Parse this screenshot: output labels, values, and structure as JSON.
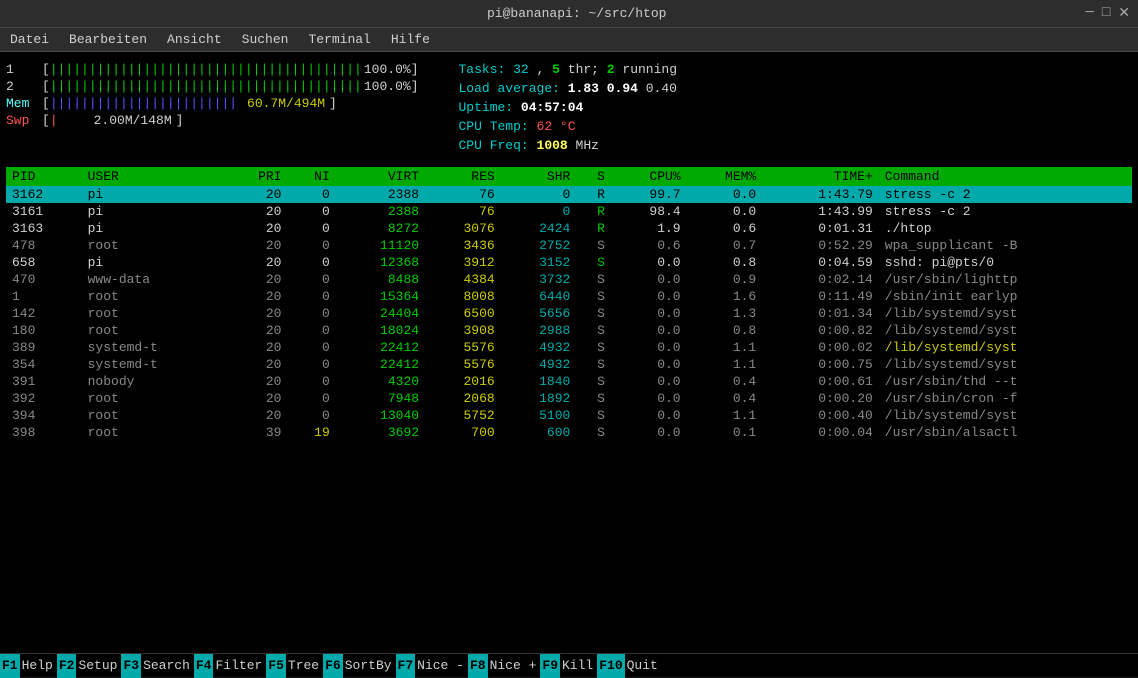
{
  "titlebar": {
    "title": "pi@bananapi: ~/src/htop",
    "minimize": "─",
    "maximize": "□",
    "close": "✕"
  },
  "menubar": {
    "items": [
      "Datei",
      "Bearbeiten",
      "Ansicht",
      "Suchen",
      "Terminal",
      "Hilfe"
    ]
  },
  "cpu_meters": {
    "cpu1_label": "1",
    "cpu1_bar": "||||||||||||||||||||||||||||||||||||||||",
    "cpu1_value": "100.0%",
    "cpu2_label": "2",
    "cpu2_bar": "||||||||||||||||||||||||||||||||||||||||",
    "cpu2_value": "100.0%",
    "mem_label": "Mem",
    "mem_bar": "||||||||||||||||||||||||",
    "mem_value": "60.7M/494M",
    "swp_label": "Swp",
    "swp_bar": "|",
    "swp_value": "2.00M/148M"
  },
  "right_stats": {
    "tasks_label": "Tasks:",
    "tasks_count": "32",
    "tasks_thr": "5",
    "tasks_running": "2",
    "tasks_text": " thr;",
    "tasks_running_label": " running",
    "load_label": "Load average:",
    "load_1": "1.83",
    "load_5": "0.94",
    "load_15": "0.40",
    "uptime_label": "Uptime:",
    "uptime_value": "04:57:04",
    "cpu_temp_label": "CPU Temp:",
    "cpu_temp_value": "62",
    "cpu_temp_unit": " °C",
    "cpu_freq_label": "CPU Freq:",
    "cpu_freq_value": "1008",
    "cpu_freq_unit": " MHz"
  },
  "table": {
    "headers": [
      "PID",
      "USER",
      "PRI",
      "NI",
      "VIRT",
      "RES",
      "SHR",
      "S",
      "CPU%",
      "MEM%",
      "TIME+",
      "Command"
    ],
    "rows": [
      {
        "pid": "3162",
        "user": "pi",
        "pri": "20",
        "ni": "0",
        "virt": "2388",
        "res": "76",
        "shr": "0",
        "s": "R",
        "cpu": "99.7",
        "mem": "0.0",
        "time": "1:43.79",
        "cmd": "stress -c 2",
        "selected": true
      },
      {
        "pid": "3161",
        "user": "pi",
        "pri": "20",
        "ni": "0",
        "virt": "2388",
        "res": "76",
        "shr": "0",
        "s": "R",
        "cpu": "98.4",
        "mem": "0.0",
        "time": "1:43.99",
        "cmd": "stress -c 2"
      },
      {
        "pid": "3163",
        "user": "pi",
        "pri": "20",
        "ni": "0",
        "virt": "8272",
        "res": "3076",
        "shr": "2424",
        "s": "R",
        "cpu": "1.9",
        "mem": "0.6",
        "time": "0:01.31",
        "cmd": "./htop"
      },
      {
        "pid": "478",
        "user": "root",
        "pri": "20",
        "ni": "0",
        "virt": "11120",
        "res": "3436",
        "shr": "2752",
        "s": "S",
        "cpu": "0.6",
        "mem": "0.7",
        "time": "0:52.29",
        "cmd": "wpa_supplicant -B",
        "gray": true
      },
      {
        "pid": "658",
        "user": "pi",
        "pri": "20",
        "ni": "0",
        "virt": "12368",
        "res": "3912",
        "shr": "3152",
        "s": "S",
        "cpu": "0.0",
        "mem": "0.8",
        "time": "0:04.59",
        "cmd": "sshd: pi@pts/0"
      },
      {
        "pid": "470",
        "user": "www-data",
        "pri": "20",
        "ni": "0",
        "virt": "8488",
        "res": "4384",
        "shr": "3732",
        "s": "S",
        "cpu": "0.0",
        "mem": "0.9",
        "time": "0:02.14",
        "cmd": "/usr/sbin/lighttp",
        "gray": true
      },
      {
        "pid": "1",
        "user": "root",
        "pri": "20",
        "ni": "0",
        "virt": "15364",
        "res": "8008",
        "shr": "6440",
        "s": "S",
        "cpu": "0.0",
        "mem": "1.6",
        "time": "0:11.49",
        "cmd": "/sbin/init earlyp",
        "gray": true
      },
      {
        "pid": "142",
        "user": "root",
        "pri": "20",
        "ni": "0",
        "virt": "24404",
        "res": "6500",
        "shr": "5656",
        "s": "S",
        "cpu": "0.0",
        "mem": "1.3",
        "time": "0:01.34",
        "cmd": "/lib/systemd/syst",
        "gray": true
      },
      {
        "pid": "180",
        "user": "root",
        "pri": "20",
        "ni": "0",
        "virt": "18024",
        "res": "3908",
        "shr": "2988",
        "s": "S",
        "cpu": "0.0",
        "mem": "0.8",
        "time": "0:00.82",
        "cmd": "/lib/systemd/syst",
        "gray": true
      },
      {
        "pid": "389",
        "user": "systemd-t",
        "pri": "20",
        "ni": "0",
        "virt": "22412",
        "res": "5576",
        "shr": "4932",
        "s": "S",
        "cpu": "0.0",
        "mem": "1.1",
        "time": "0:00.02",
        "cmd": "/lib/systemd/syst",
        "gray": true,
        "cmd_yellow": true
      },
      {
        "pid": "354",
        "user": "systemd-t",
        "pri": "20",
        "ni": "0",
        "virt": "22412",
        "res": "5576",
        "shr": "4932",
        "s": "S",
        "cpu": "0.0",
        "mem": "1.1",
        "time": "0:00.75",
        "cmd": "/lib/systemd/syst",
        "gray": true
      },
      {
        "pid": "391",
        "user": "nobody",
        "pri": "20",
        "ni": "0",
        "virt": "4320",
        "res": "2016",
        "shr": "1840",
        "s": "S",
        "cpu": "0.0",
        "mem": "0.4",
        "time": "0:00.61",
        "cmd": "/usr/sbin/thd --t",
        "gray": true
      },
      {
        "pid": "392",
        "user": "root",
        "pri": "20",
        "ni": "0",
        "virt": "7948",
        "res": "2068",
        "shr": "1892",
        "s": "S",
        "cpu": "0.0",
        "mem": "0.4",
        "time": "0:00.20",
        "cmd": "/usr/sbin/cron -f",
        "gray": true
      },
      {
        "pid": "394",
        "user": "root",
        "pri": "20",
        "ni": "0",
        "virt": "13040",
        "res": "5752",
        "shr": "5100",
        "s": "S",
        "cpu": "0.0",
        "mem": "1.1",
        "time": "0:00.40",
        "cmd": "/lib/systemd/syst",
        "gray": true
      },
      {
        "pid": "398",
        "user": "root",
        "pri": "39",
        "ni": "19",
        "virt": "3692",
        "res": "700",
        "shr": "600",
        "s": "S",
        "cpu": "0.0",
        "mem": "0.1",
        "time": "0:00.04",
        "cmd": "/usr/sbin/alsactl",
        "gray": true,
        "ni_yellow": true
      }
    ]
  },
  "funcbar": {
    "keys": [
      {
        "num": "F1",
        "label": "Help"
      },
      {
        "num": "F2",
        "label": "Setup"
      },
      {
        "num": "F3",
        "label": "Search"
      },
      {
        "num": "F4",
        "label": "Filter"
      },
      {
        "num": "F5",
        "label": "Tree"
      },
      {
        "num": "F6",
        "label": "SortBy"
      },
      {
        "num": "F7",
        "label": "Nice -"
      },
      {
        "num": "F8",
        "label": "Nice +"
      },
      {
        "num": "F9",
        "label": "Kill"
      },
      {
        "num": "F10",
        "label": "Quit"
      }
    ]
  }
}
